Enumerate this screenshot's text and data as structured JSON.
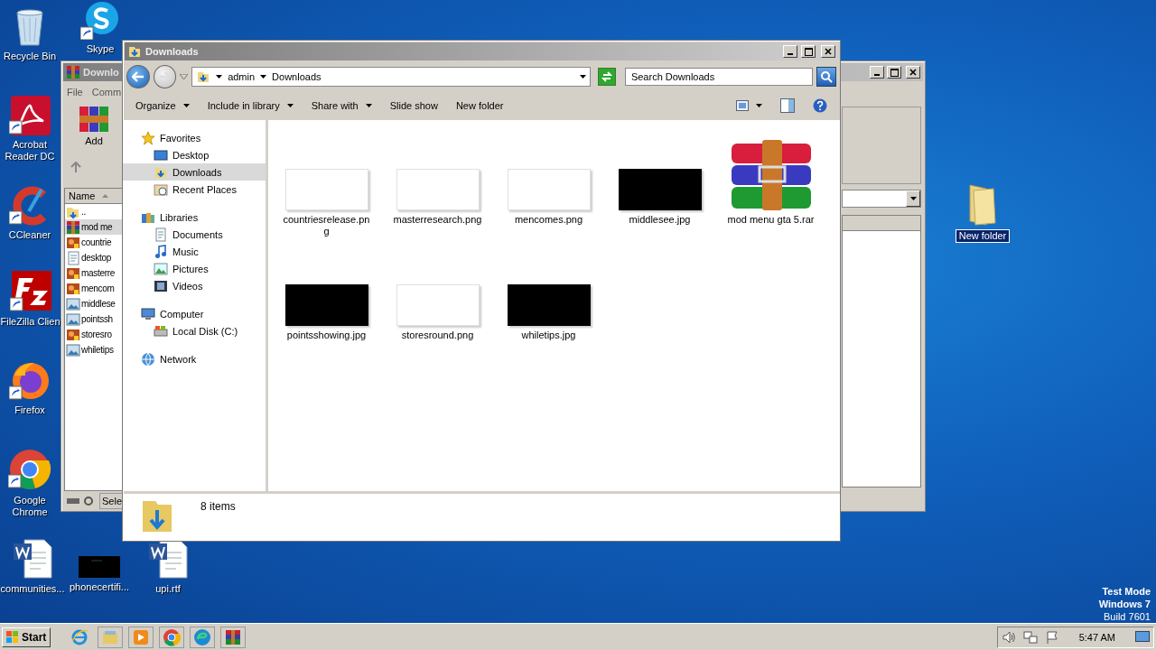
{
  "desktop_icons": [
    {
      "label": "Recycle Bin",
      "kind": "recycle-bin"
    },
    {
      "label": "Skype",
      "kind": "skype"
    },
    {
      "label": "Acrobat Reader DC",
      "kind": "acrobat"
    },
    {
      "label": "CCleaner",
      "kind": "ccleaner"
    },
    {
      "label": "FileZilla Clien",
      "kind": "filezilla"
    },
    {
      "label": "Firefox",
      "kind": "firefox"
    },
    {
      "label": "Google Chrome",
      "kind": "chrome"
    },
    {
      "label": "communities...",
      "kind": "word"
    },
    {
      "label": "phonecertifi...",
      "kind": "dark-image"
    },
    {
      "label": "upi.rtf",
      "kind": "word"
    },
    {
      "label": "New folder",
      "kind": "folder",
      "selected": true
    }
  ],
  "back_window": {
    "title": "Downlo",
    "menu": [
      "File",
      "Comm"
    ],
    "add_button": "Add",
    "column_header": "Name",
    "rows": [
      {
        "name": "..",
        "kind": "up",
        "selected": false
      },
      {
        "name": "mod me",
        "kind": "archive",
        "selected": true
      },
      {
        "name": "countrie",
        "kind": "png",
        "selected": false
      },
      {
        "name": "desktop",
        "kind": "document",
        "selected": false
      },
      {
        "name": "masterre",
        "kind": "png",
        "selected": false
      },
      {
        "name": "mencom",
        "kind": "png",
        "selected": false
      },
      {
        "name": "middlese",
        "kind": "jpg",
        "selected": false
      },
      {
        "name": "pointssh",
        "kind": "jpg",
        "selected": false
      },
      {
        "name": "storesro",
        "kind": "png",
        "selected": false
      },
      {
        "name": "whiletips",
        "kind": "jpg",
        "selected": false
      }
    ],
    "status": "Sele"
  },
  "explorer": {
    "title": "Downloads",
    "breadcrumb": [
      "admin",
      "Downloads"
    ],
    "search": {
      "placeholder": "Search Downloads"
    },
    "toolbar": [
      {
        "label": "Organize",
        "dropdown": true
      },
      {
        "label": "Include in library",
        "dropdown": true
      },
      {
        "label": "Share with",
        "dropdown": true
      },
      {
        "label": "Slide show",
        "dropdown": false
      },
      {
        "label": "New folder",
        "dropdown": false
      }
    ],
    "nav": [
      {
        "label": "Favorites",
        "kind": "star",
        "selected": false,
        "children": [
          {
            "label": "Desktop",
            "kind": "desktop",
            "selected": false
          },
          {
            "label": "Downloads",
            "kind": "downloads",
            "selected": true
          },
          {
            "label": "Recent Places",
            "kind": "recent",
            "selected": false
          }
        ]
      },
      {
        "label": "Libraries",
        "kind": "library",
        "selected": false,
        "children": [
          {
            "label": "Documents",
            "kind": "documents",
            "selected": false
          },
          {
            "label": "Music",
            "kind": "music",
            "selected": false
          },
          {
            "label": "Pictures",
            "kind": "pictures",
            "selected": false
          },
          {
            "label": "Videos",
            "kind": "videos",
            "selected": false
          }
        ]
      },
      {
        "label": "Computer",
        "kind": "computer",
        "selected": false,
        "children": [
          {
            "label": "Local Disk (C:)",
            "kind": "disk",
            "selected": false
          }
        ]
      },
      {
        "label": "Network",
        "kind": "network",
        "selected": false
      }
    ],
    "files": [
      {
        "name": "countriesrelease.png",
        "kind": "light-image"
      },
      {
        "name": "masterresearch.png",
        "kind": "light-image"
      },
      {
        "name": "mencomes.png",
        "kind": "light-image"
      },
      {
        "name": "middlesee.jpg",
        "kind": "dark-image"
      },
      {
        "name": "mod menu gta 5.rar",
        "kind": "archive"
      },
      {
        "name": "pointsshowing.jpg",
        "kind": "dark-image"
      },
      {
        "name": "storesround.png",
        "kind": "light-image"
      },
      {
        "name": "whiletips.jpg",
        "kind": "dark-image"
      }
    ],
    "details": {
      "count": "8 items"
    }
  },
  "system_notice": [
    "Test Mode",
    "Windows 7",
    "Build 7601"
  ],
  "taskbar": {
    "start": "Start",
    "pinned": [
      {
        "kind": "ie"
      },
      {
        "kind": "explorer"
      },
      {
        "kind": "media"
      },
      {
        "kind": "chrome"
      },
      {
        "kind": "edge"
      },
      {
        "kind": "winrar"
      }
    ],
    "tray": [
      {
        "kind": "speaker"
      },
      {
        "kind": "network"
      },
      {
        "kind": "flag"
      }
    ],
    "clock": "5:47 AM"
  }
}
